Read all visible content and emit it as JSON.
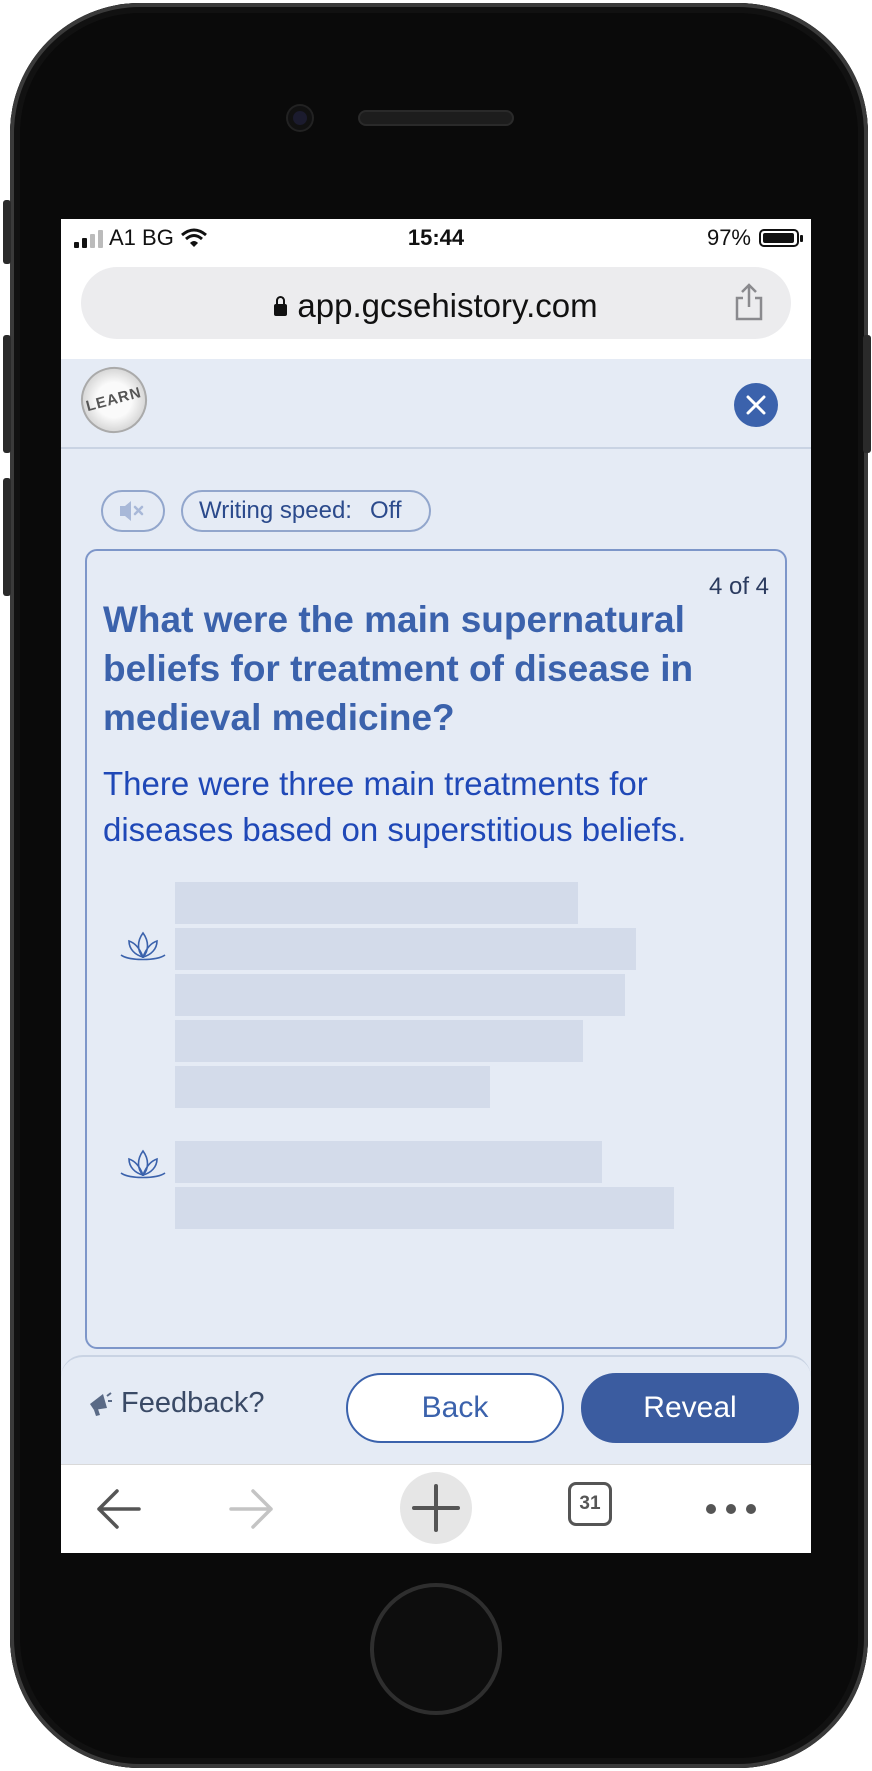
{
  "status_bar": {
    "carrier": "A1 BG",
    "time": "15:44",
    "battery": "97%"
  },
  "browser": {
    "url": "app.gcsehistory.com",
    "tab_count": "31"
  },
  "app_header": {
    "logo_text": "LEARN",
    "close_icon": "close-icon"
  },
  "controls": {
    "mute_icon": "speaker-muted-icon",
    "writing_speed_label": "Writing speed:",
    "writing_speed_value": "Off"
  },
  "card": {
    "counter": "4 of 4",
    "question": "What were the main supernatural beliefs for treatment of disease in medieval medicine?",
    "answer": "There were three main treatments for diseases based on superstitious beliefs.",
    "bullet_icon": "lotus-icon"
  },
  "footer": {
    "feedback": "Feedback?",
    "back": "Back",
    "reveal": "Reveal"
  },
  "colors": {
    "accent": "#3b62ac",
    "answer_text": "#1f48b7",
    "background": "#e5ebf5",
    "placeholder": "#d3dbea"
  }
}
